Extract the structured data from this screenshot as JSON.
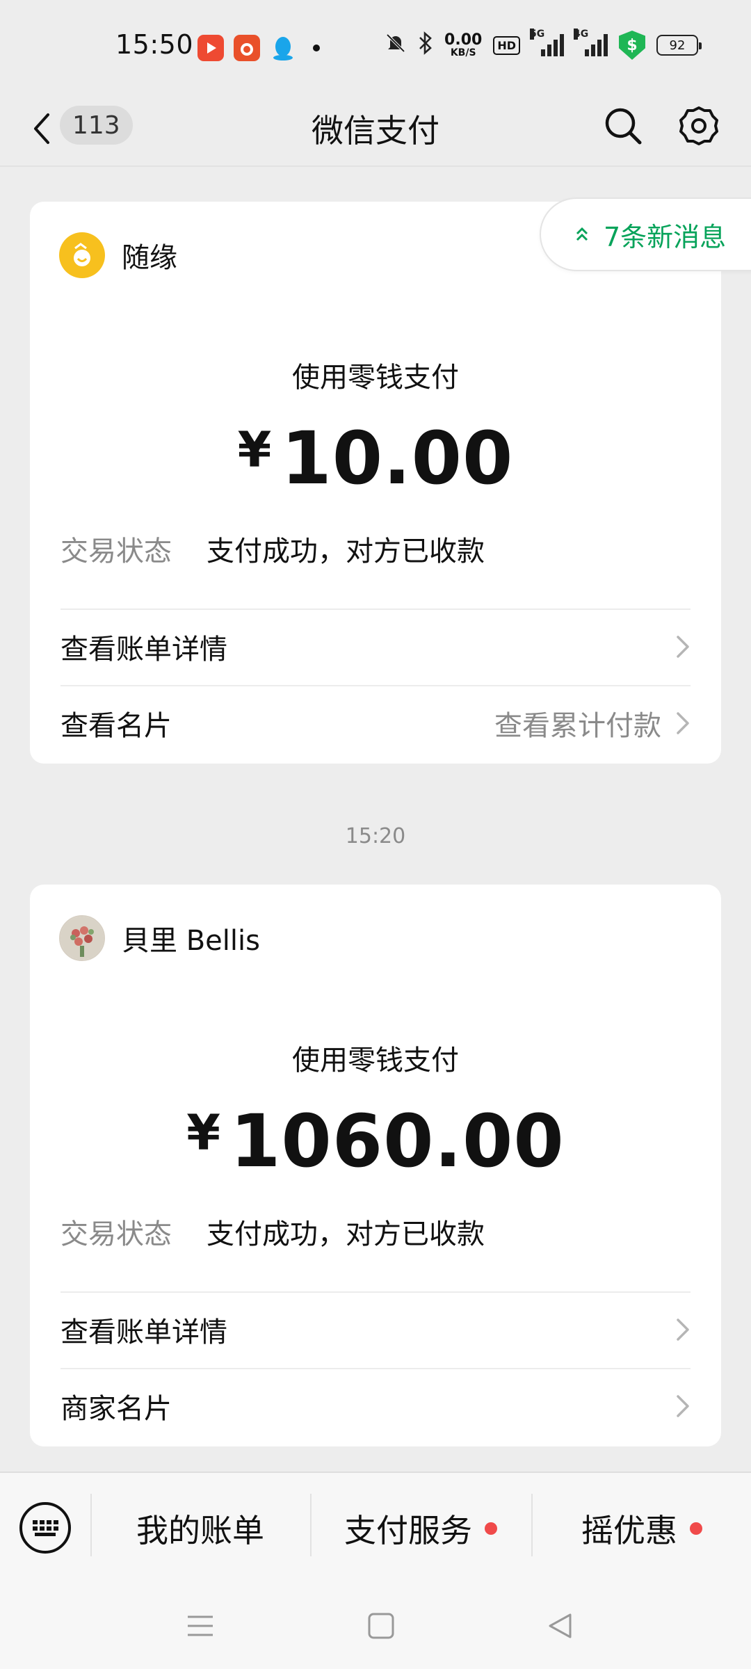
{
  "status_bar": {
    "time": "15:50",
    "net_speed_value": "0.00",
    "net_speed_unit": "KB/S",
    "hd_label": "HD",
    "sig1_label": "5G",
    "sig2_label": "4G",
    "shield_symbol": "$",
    "battery": "92"
  },
  "header": {
    "back_count": "113",
    "title": "微信支付"
  },
  "new_messages": {
    "label": "7条新消息"
  },
  "cards": [
    {
      "merchant": "随缘",
      "pay_method": "使用零钱支付",
      "currency": "¥",
      "amount": "10.00",
      "status_label": "交易状态",
      "status_value": "支付成功，对方已收款",
      "row1_label": "查看账单详情",
      "row2_label": "查看名片",
      "row2_hint": "查看累计付款"
    },
    {
      "merchant": "貝里 Bellis",
      "pay_method": "使用零钱支付",
      "currency": "¥",
      "amount": "1060.00",
      "status_label": "交易状态",
      "status_value": "支付成功，对方已收款",
      "row1_label": "查看账单详情",
      "row2_label": "商家名片"
    }
  ],
  "timestamp": "15:20",
  "bottom_tabs": [
    {
      "label": "我的账单"
    },
    {
      "label": "支付服务"
    },
    {
      "label": "摇优惠"
    }
  ],
  "colors": {
    "accent_green": "#07a35a",
    "red_dot": "#f04a4a",
    "background": "#ededed"
  }
}
